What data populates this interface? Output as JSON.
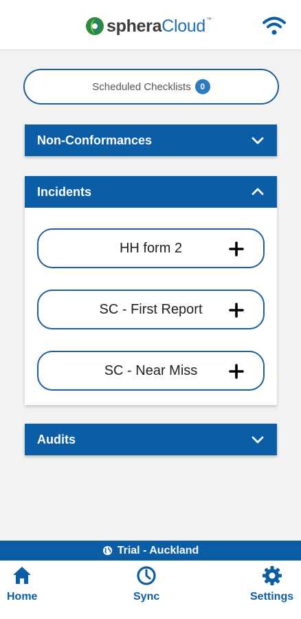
{
  "app": {
    "logo_primary": "sphera",
    "logo_secondary": "Cloud",
    "logo_tm": "™",
    "wifi_icon": "wifi-icon"
  },
  "scheduled": {
    "label": "Scheduled Checklists",
    "count": "0"
  },
  "sections": {
    "nonconformances": {
      "title": "Non-Conformances",
      "expanded": false
    },
    "incidents": {
      "title": "Incidents",
      "expanded": true,
      "forms": [
        {
          "label": "HH form 2"
        },
        {
          "label": "SC - First Report"
        },
        {
          "label": "SC - Near Miss"
        }
      ]
    },
    "audits": {
      "title": "Audits",
      "expanded": false
    }
  },
  "status": {
    "label": "Trial - Auckland",
    "icon": "globe-icon"
  },
  "tabs": [
    {
      "label": "Home",
      "icon": "home-icon"
    },
    {
      "label": "Sync",
      "icon": "clock-icon"
    },
    {
      "label": "Settings",
      "icon": "gear-icon"
    }
  ],
  "colors": {
    "primary": "#0b5da6",
    "accent": "#2b7bc1",
    "logo_green": "#4caf50"
  }
}
